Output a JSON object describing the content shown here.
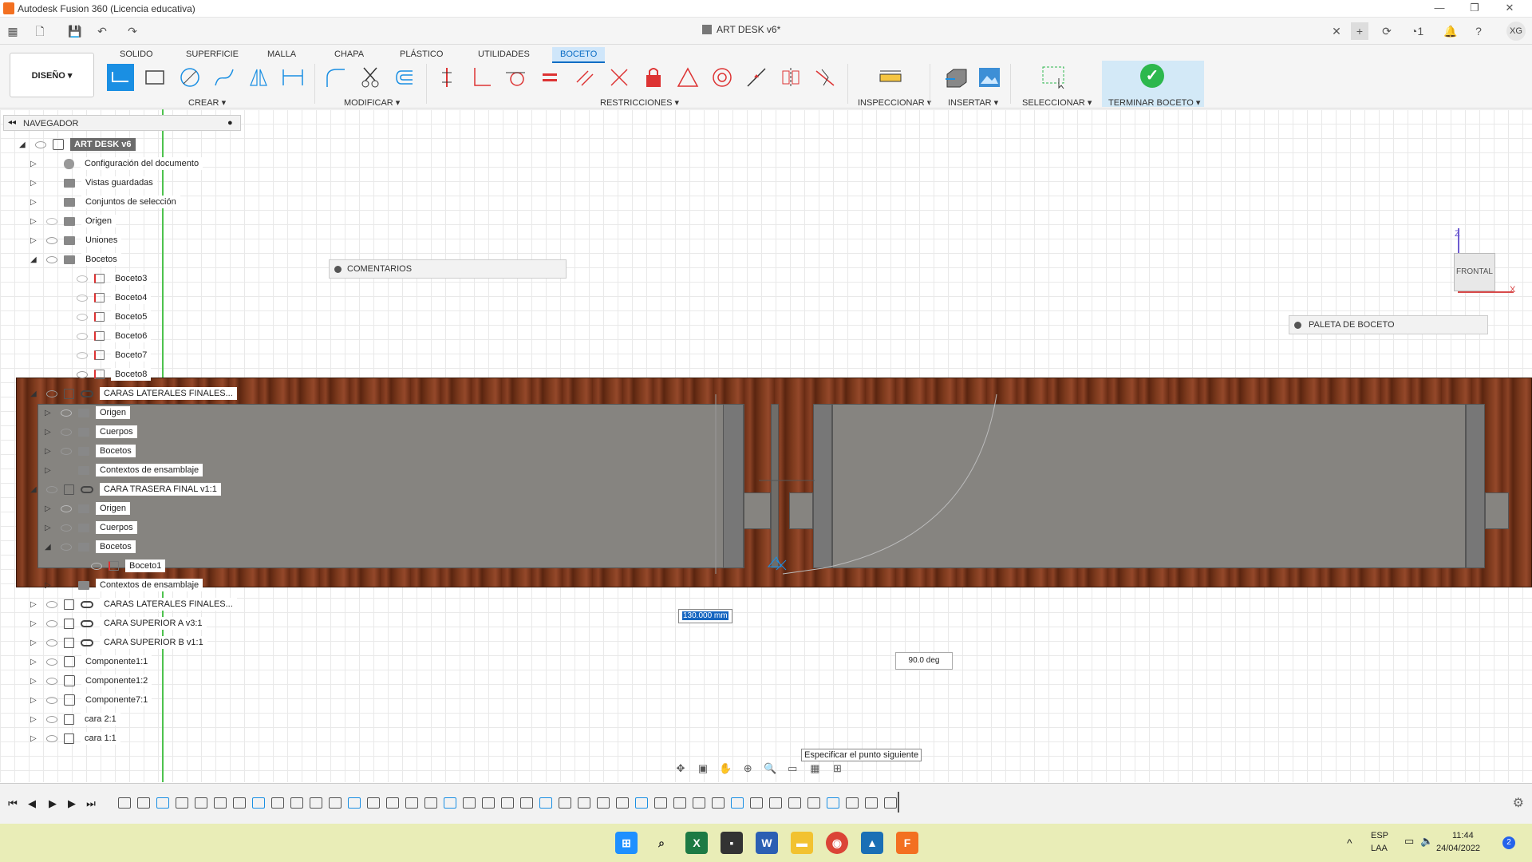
{
  "window": {
    "title": "Autodesk Fusion 360 (Licencia educativa)"
  },
  "document_tab": {
    "title": "ART DESK v6*"
  },
  "user": {
    "initials": "XG"
  },
  "notifications": {
    "count": "1"
  },
  "ribbon": {
    "tabs": [
      "SOLIDO",
      "SUPERFICIE",
      "MALLA",
      "CHAPA",
      "PLÁSTICO",
      "UTILIDADES",
      "BOCETO"
    ],
    "active_tab": "BOCETO",
    "workspace": "DISEÑO",
    "groups": [
      "CREAR",
      "MODIFICAR",
      "RESTRICCIONES",
      "INSPECCIONAR",
      "INSERTAR",
      "SELECCIONAR"
    ],
    "finish": "TERMINAR BOCETO"
  },
  "navigator": {
    "title": "NAVEGADOR",
    "rows": [
      {
        "label": "ART DESK v6"
      },
      {
        "label": "Configuración del documento"
      },
      {
        "label": "Vistas guardadas"
      },
      {
        "label": "Conjuntos de selección"
      },
      {
        "label": "Origen"
      },
      {
        "label": "Uniones"
      },
      {
        "label": "Bocetos"
      },
      {
        "label": "Boceto3"
      },
      {
        "label": "Boceto4"
      },
      {
        "label": "Boceto5"
      },
      {
        "label": "Boceto6"
      },
      {
        "label": "Boceto7"
      },
      {
        "label": "Boceto8"
      },
      {
        "label": "CARAS LATERALES FINALES..."
      },
      {
        "label": "Origen"
      },
      {
        "label": "Cuerpos"
      },
      {
        "label": "Bocetos"
      },
      {
        "label": "Contextos de ensamblaje"
      },
      {
        "label": "CARA TRASERA  FINAL v1:1"
      },
      {
        "label": "Origen"
      },
      {
        "label": "Cuerpos"
      },
      {
        "label": "Bocetos"
      },
      {
        "label": "Boceto1"
      },
      {
        "label": "Contextos de ensamblaje"
      },
      {
        "label": "CARAS LATERALES FINALES..."
      },
      {
        "label": "CARA SUPERIOR A v3:1"
      },
      {
        "label": "CARA SUPERIOR B v1:1"
      },
      {
        "label": "Componente1:1"
      },
      {
        "label": "Componente1:2"
      },
      {
        "label": "Componente7:1"
      },
      {
        "label": "cara 2:1"
      },
      {
        "label": "cara 1:1"
      }
    ]
  },
  "panels": {
    "comments": "COMENTARIOS",
    "sketch_palette": "PALETA DE BOCETO"
  },
  "viewcube": {
    "face": "FRONTAL",
    "z": "Z",
    "x": "X"
  },
  "sketch": {
    "dimension_value": "130.000 mm",
    "angle_value": "90.0 deg",
    "tooltip": "Especificar el punto siguiente"
  },
  "taskbar": {
    "lang": "ESP",
    "layout": "LAA",
    "time": "11:44",
    "date": "24/04/2022",
    "badge": "2"
  },
  "colors": {
    "accent": "#1a8fe3",
    "finish": "#2db84d",
    "wood": "#7d3a1d"
  }
}
